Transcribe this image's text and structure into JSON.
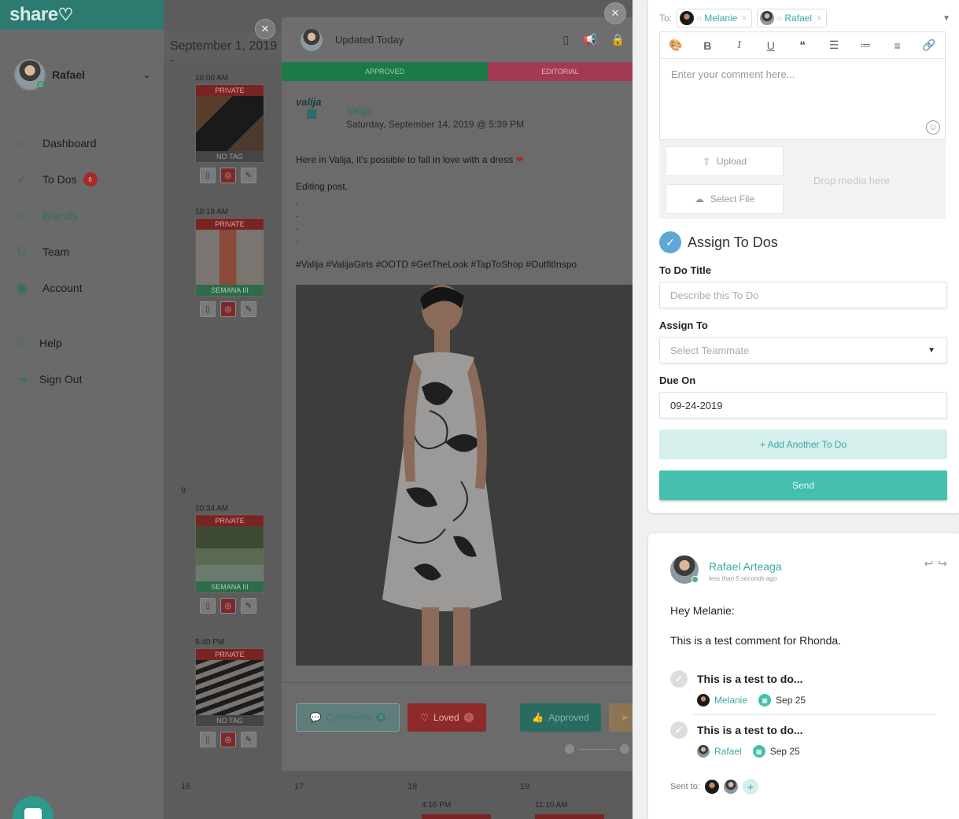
{
  "app": {
    "logo_text": "share"
  },
  "user": {
    "name": "Rafael"
  },
  "nav": {
    "items": [
      {
        "label": "Dashboard",
        "icon": "home-icon"
      },
      {
        "label": "To Dos",
        "icon": "check-icon",
        "badge": "6"
      },
      {
        "label": "Brands",
        "icon": "star-icon"
      },
      {
        "label": "Team",
        "icon": "team-icon"
      },
      {
        "label": "Account",
        "icon": "briefcase-icon"
      }
    ],
    "secondary": [
      {
        "label": "Help",
        "icon": "help-icon"
      },
      {
        "label": "Sign Out",
        "icon": "sign-out-icon"
      }
    ]
  },
  "calendar": {
    "date_heading": "September 1, 2019 -",
    "week_num_9": "9",
    "posts": [
      {
        "time": "10:00 AM",
        "top_tag": "PRIVATE",
        "bottom_tag": "NO TAG"
      },
      {
        "time": "10:18 AM",
        "top_tag": "PRIVATE",
        "bottom_tag": "SEMANA III"
      },
      {
        "time": "10:34 AM",
        "top_tag": "PRIVATE",
        "bottom_tag": "SEMANA III"
      },
      {
        "time": "5:40 PM",
        "top_tag": "PRIVATE",
        "bottom_tag": "NO TAG"
      }
    ],
    "next_week": {
      "days": [
        "16",
        "17",
        "18",
        "19"
      ],
      "times": [
        "4:16 PM",
        "11:10 AM"
      ]
    }
  },
  "post": {
    "updated": "Updated Today",
    "status_approved": "APPROVED",
    "status_editorial": "EDITORIAL",
    "brand_logo": "valija",
    "brand_name": "Valija",
    "date": "Saturday, September 14, 2019 @ 5:39 PM",
    "caption_line1": "Here in Valija, it's possible to fall in love with a dress",
    "caption_line2": "Editing post.",
    "dots": [
      ".",
      ".",
      ".",
      "."
    ],
    "hashtags": "#Valija #ValijaGirls #OOTD #GetTheLook #TapToShop #OutfitInspo",
    "buttons": {
      "comments": "Comments",
      "comments_count": "0",
      "loved": "Loved",
      "loved_count": "0",
      "approved": "Approved"
    }
  },
  "compose": {
    "to_label": "To:",
    "recipients": [
      "Melanie",
      "Rafael"
    ],
    "toolbar": [
      "palette-icon",
      "bold-icon",
      "italic-icon",
      "underline-icon",
      "quote-icon",
      "bullet-list-icon",
      "numbered-list-icon",
      "align-icon",
      "link-icon"
    ],
    "comment_placeholder": "Enter your comment here...",
    "upload_label": "Upload",
    "select_file_label": "Select File",
    "drop_media": "Drop media here",
    "assign_title": "Assign To Dos",
    "todo_title_label": "To Do Title",
    "todo_title_placeholder": "Describe this To Do",
    "assign_to_label": "Assign To",
    "assign_to_placeholder": "Select Teammate",
    "due_on_label": "Due On",
    "due_on_value": "09-24-2019",
    "add_another": "+ Add Another To Do",
    "send": "Send"
  },
  "comment": {
    "author": "Rafael Arteaga",
    "time": "less than 5 seconds ago",
    "greeting": "Hey Melanie:",
    "body": "This is a test comment for Rhonda.",
    "todos": [
      {
        "title": "This is a test to do...",
        "assignee": "Melanie",
        "due": "Sep 25"
      },
      {
        "title": "This is a test to do...",
        "assignee": "Rafael",
        "due": "Sep 25"
      }
    ],
    "sent_to_label": "Sent to:"
  }
}
